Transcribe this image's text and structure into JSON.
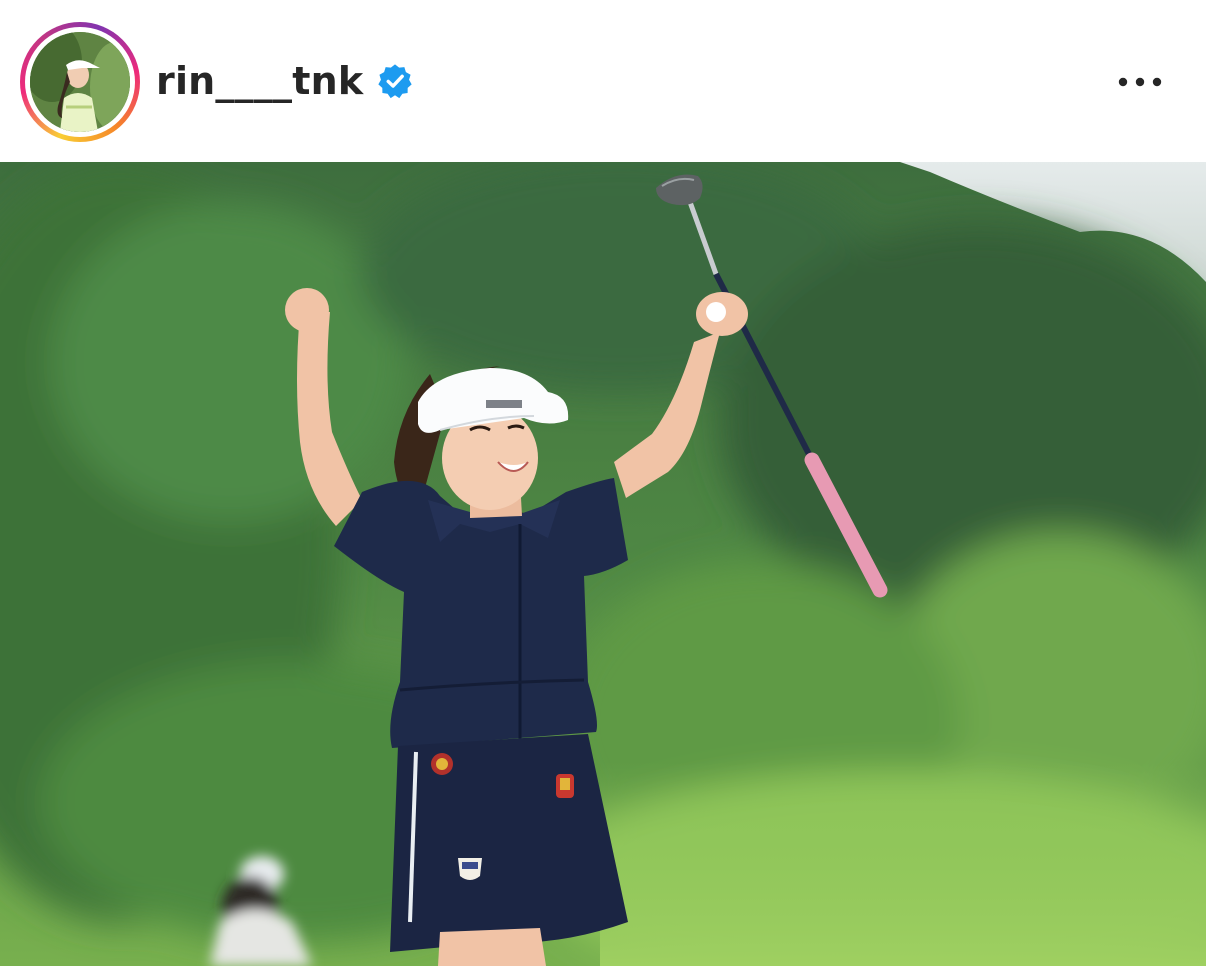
{
  "post": {
    "author": {
      "username": "rin____tnk",
      "verified": true,
      "avatar_icon": "profile-photo",
      "story_ring_colors": [
        "#f9ce34",
        "#ee2a7b",
        "#6228d7"
      ]
    },
    "more_icon": "more-horizontal-icon",
    "verified_icon": "verified-badge-icon",
    "verified_color": "#1d9bf0",
    "image": {
      "description_icon": "golfer-celebrating-photo"
    }
  }
}
